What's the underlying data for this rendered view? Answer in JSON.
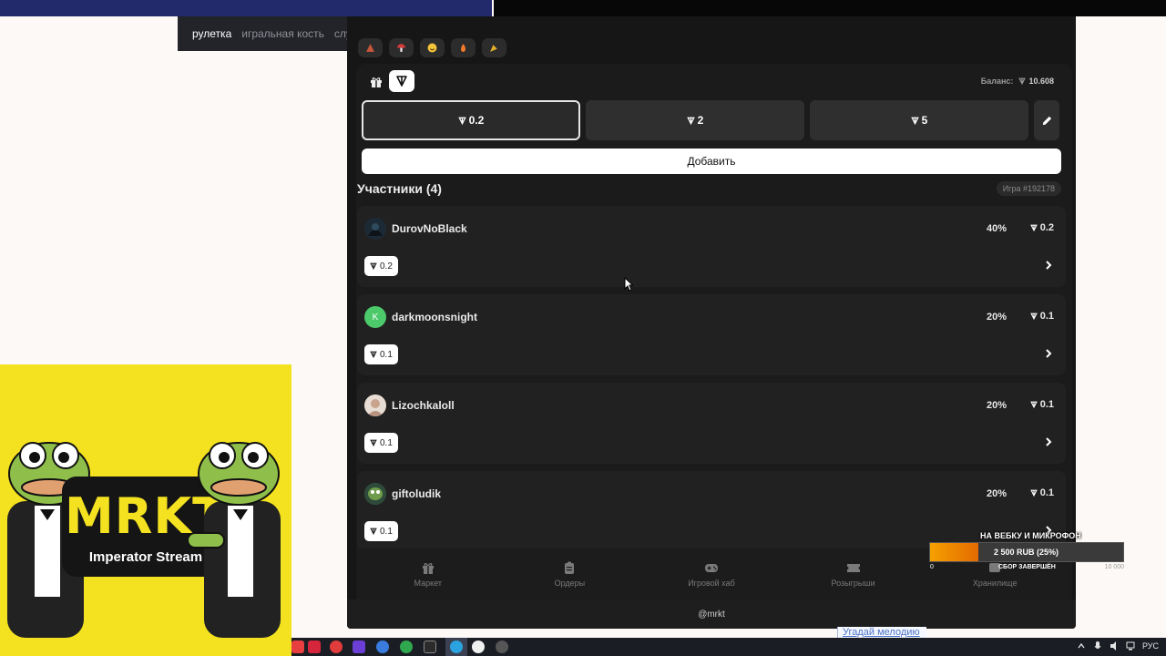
{
  "browser_tabs": [
    "рулетка",
    "игральная кость",
    "случ"
  ],
  "stream_overlay": {
    "logo": "MRKT",
    "subtitle": "Imperator Stream"
  },
  "emoji_filters": [
    {
      "icon": "triangle-flag-icon",
      "color": "#c7563a"
    },
    {
      "icon": "mushroom-icon",
      "color": "#d33a3a"
    },
    {
      "icon": "smiley-icon",
      "color": "#f4c43a"
    },
    {
      "icon": "flame-icon",
      "color": "#f07a2a"
    },
    {
      "icon": "party-popper-icon",
      "color": "#e3b02a"
    }
  ],
  "header": {
    "balance_label": "Баланс:",
    "balance_value": "10.608"
  },
  "bets": [
    {
      "label": "0.2",
      "selected": true
    },
    {
      "label": "2",
      "selected": false
    },
    {
      "label": "5",
      "selected": false
    }
  ],
  "add_button": "Добавить",
  "participants": {
    "title": "Участники (4)",
    "game_id": "Игра #192178",
    "rows": [
      {
        "name": "DurovNoBlack",
        "percent": "40%",
        "amount": "0.2",
        "chip": "0.2",
        "avatar_letter": "",
        "avatar_color": "#1c2a36"
      },
      {
        "name": "darkmoonsnight",
        "percent": "20%",
        "amount": "0.1",
        "chip": "0.1",
        "avatar_letter": "K",
        "avatar_color": "#4cc96a"
      },
      {
        "name": "Lizochkaloll",
        "percent": "20%",
        "amount": "0.1",
        "chip": "0.1",
        "avatar_letter": "",
        "avatar_color": "#d9c6b8"
      },
      {
        "name": "giftoludik",
        "percent": "20%",
        "amount": "0.1",
        "chip": "0.1",
        "avatar_letter": "",
        "avatar_color": "#3d6b49"
      }
    ]
  },
  "bottom_nav": [
    "Маркет",
    "Ордеры",
    "Игровой хаб",
    "Розыгрыши",
    "Хранилище"
  ],
  "footer": "@mrkt",
  "donation_goal": {
    "title": "НА ВЕБКУ И МИКРОФОН",
    "amount": "2 500 RUB (25%)",
    "progress": 0.25,
    "min": "0",
    "status": "СБОР ЗАВЕРШЁН",
    "max": "10 000"
  },
  "background_link": "Угадай мелодию",
  "taskbar": {
    "language": "РУС"
  },
  "colors": {
    "accent_white": "#ffffff",
    "panel_bg": "#1b1b1b",
    "row_bg": "#212121",
    "donation_orange": "#f5a000"
  }
}
